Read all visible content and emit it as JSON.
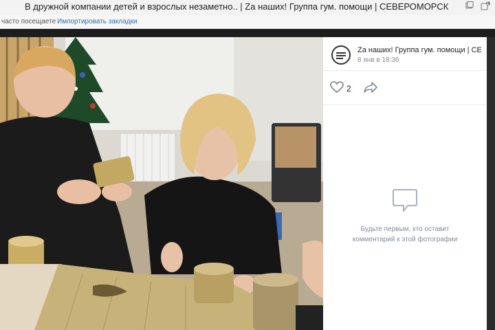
{
  "browser": {
    "title": "В дружной компании детей и взрослых незаметно.. | Zа наших! Группа гум. помощи | СЕВЕРОМОРСК",
    "tab_count": "1"
  },
  "bookmarks": {
    "often_visited": "часто посещаете",
    "import_label": "Импортировать закладки"
  },
  "post": {
    "group_name": "Zа наших! Группа гум. помощи | СЕ...",
    "date": "8 янв в 18:36",
    "likes": "2"
  },
  "comments": {
    "empty_line1": "Будьте первым, кто оставит",
    "empty_line2": "комментарий к этой фотографии"
  },
  "colors": {
    "accent": "#2a6ebb",
    "secondary_text": "#818c99",
    "viewer_bg": "#1d1d1d"
  },
  "icons": [
    "browser-page-icon",
    "extension-icon",
    "avatar-logo",
    "heart-icon",
    "share-icon",
    "comment-bubble-icon"
  ]
}
